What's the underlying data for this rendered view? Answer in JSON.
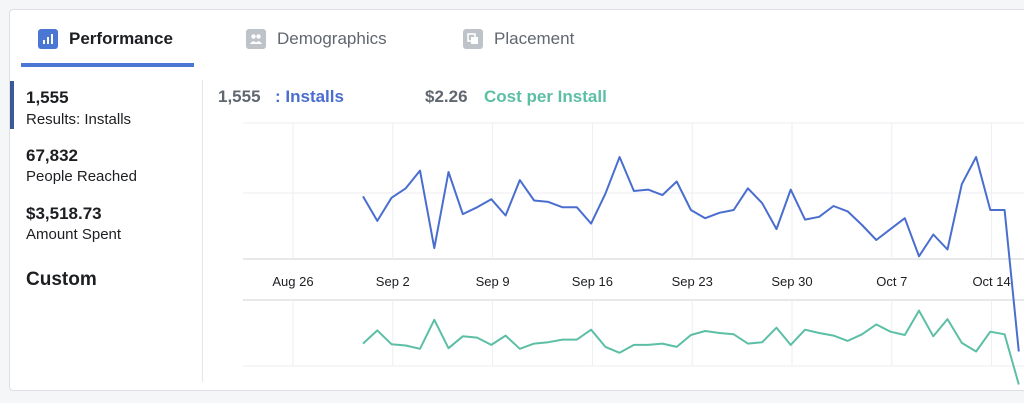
{
  "tabs": [
    {
      "label": "Performance",
      "icon": "bar-chart-icon",
      "active": true
    },
    {
      "label": "Demographics",
      "icon": "people-icon",
      "active": false
    },
    {
      "label": "Placement",
      "icon": "placement-icon",
      "active": false
    }
  ],
  "sidebar": {
    "metrics": [
      {
        "value": "1,555",
        "label": "Results: Installs",
        "active": true
      },
      {
        "value": "67,832",
        "label": "People Reached",
        "active": false
      },
      {
        "value": "$3,518.73",
        "label": "Amount Spent",
        "active": false
      }
    ],
    "custom_label": "Custom"
  },
  "summary": {
    "installs_value": "1,555",
    "installs_label": ": Installs",
    "cpi_value": "$2.26",
    "cpi_label": "Cost per Install"
  },
  "colors": {
    "accent": "#4a76d4",
    "installs": "#4a6ecf",
    "cost": "#5cbfa5",
    "active_border": "#3b5998"
  },
  "chart_data": {
    "type": "line",
    "x_ticks": [
      "Aug 26",
      "Sep 2",
      "Sep 9",
      "Sep 16",
      "Sep 23",
      "Sep 30",
      "Oct 7",
      "Oct 14"
    ],
    "x_start": "Aug 31",
    "series": [
      {
        "name": "Installs",
        "values": [
          0.46,
          0.28,
          0.45,
          0.52,
          0.65,
          0.08,
          0.64,
          0.33,
          0.38,
          0.44,
          0.32,
          0.58,
          0.43,
          0.42,
          0.38,
          0.38,
          0.26,
          0.48,
          0.75,
          0.5,
          0.51,
          0.47,
          0.57,
          0.36,
          0.3,
          0.34,
          0.36,
          0.52,
          0.41,
          0.22,
          0.51,
          0.29,
          0.31,
          0.39,
          0.35,
          0.25,
          0.14,
          0.22,
          0.3,
          0.02,
          0.18,
          0.07,
          0.55,
          0.75,
          0.36,
          0.36,
          -0.68
        ]
      },
      {
        "name": "Cost per Install",
        "values": [
          0.34,
          0.54,
          0.33,
          0.31,
          0.26,
          0.7,
          0.27,
          0.45,
          0.43,
          0.32,
          0.46,
          0.26,
          0.34,
          0.36,
          0.4,
          0.4,
          0.55,
          0.29,
          0.2,
          0.32,
          0.32,
          0.34,
          0.29,
          0.47,
          0.53,
          0.5,
          0.48,
          0.34,
          0.36,
          0.58,
          0.32,
          0.55,
          0.5,
          0.46,
          0.38,
          0.48,
          0.63,
          0.52,
          0.47,
          0.84,
          0.45,
          0.71,
          0.35,
          0.22,
          0.52,
          0.48,
          -0.28
        ]
      }
    ]
  }
}
